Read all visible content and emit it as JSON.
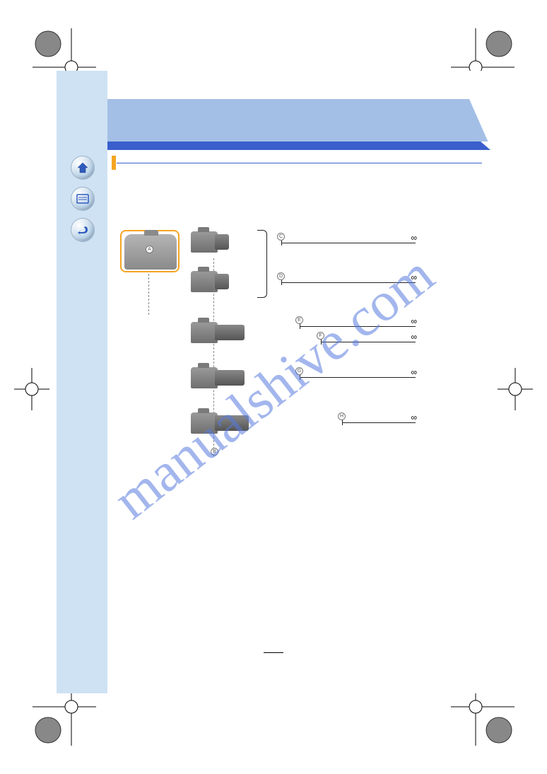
{
  "watermark": "manualshive.com",
  "nav": {
    "home": "home",
    "menu": "menu",
    "back": "back"
  },
  "diagram": {
    "label_A": "A",
    "label_B": "B",
    "label_C": "C",
    "label_D": "D",
    "label_E": "E",
    "label_F": "F",
    "label_G": "G",
    "label_H": "H",
    "infinity": "∞"
  },
  "page_number": ""
}
